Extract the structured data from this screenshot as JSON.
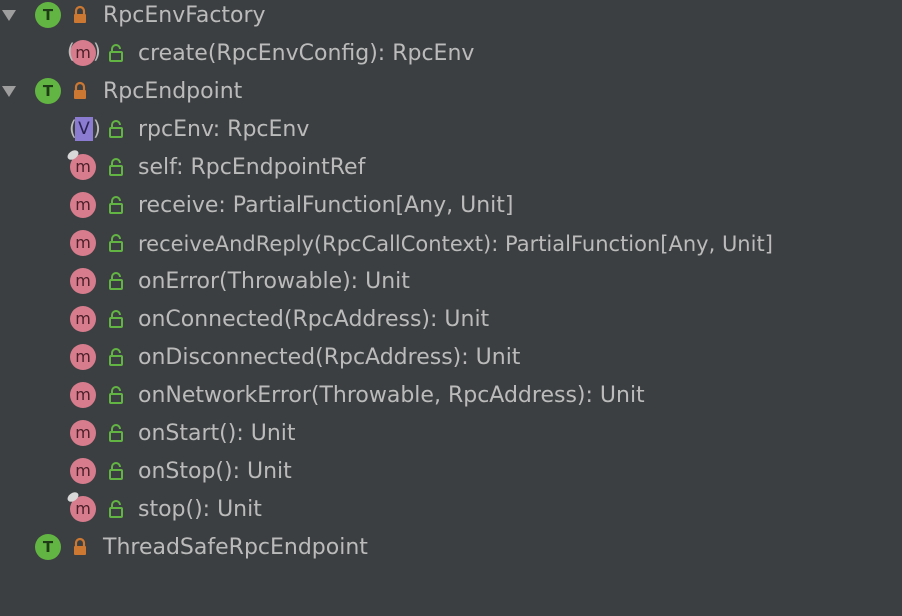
{
  "tree": {
    "items": [
      {
        "kind": "trait",
        "expanded": true,
        "icon": "trait-icon",
        "badge": "T",
        "label": "RpcEnvFactory"
      },
      {
        "kind": "method",
        "abstract": true,
        "icon": "abstract-method-icon",
        "badge": "m",
        "label": "create(RpcEnvConfig): RpcEnv"
      },
      {
        "kind": "trait",
        "expanded": true,
        "icon": "trait-icon",
        "badge": "T",
        "label": "RpcEndpoint"
      },
      {
        "kind": "value",
        "abstract": true,
        "icon": "abstract-value-icon",
        "badge": "V",
        "label": "rpcEnv: RpcEnv"
      },
      {
        "kind": "method",
        "pinned": true,
        "icon": "method-icon",
        "badge": "m",
        "label": "self: RpcEndpointRef"
      },
      {
        "kind": "method",
        "icon": "method-icon",
        "badge": "m",
        "label": "receive: PartialFunction[Any, Unit]"
      },
      {
        "kind": "method",
        "icon": "method-icon",
        "badge": "m",
        "label": "receiveAndReply(RpcCallContext): PartialFunction[Any, Unit]"
      },
      {
        "kind": "method",
        "icon": "method-icon",
        "badge": "m",
        "label": "onError(Throwable): Unit"
      },
      {
        "kind": "method",
        "icon": "method-icon",
        "badge": "m",
        "label": "onConnected(RpcAddress): Unit"
      },
      {
        "kind": "method",
        "icon": "method-icon",
        "badge": "m",
        "label": "onDisconnected(RpcAddress): Unit"
      },
      {
        "kind": "method",
        "icon": "method-icon",
        "badge": "m",
        "label": "onNetworkError(Throwable, RpcAddress): Unit"
      },
      {
        "kind": "method",
        "icon": "method-icon",
        "badge": "m",
        "label": "onStart(): Unit"
      },
      {
        "kind": "method",
        "icon": "method-icon",
        "badge": "m",
        "label": "onStop(): Unit"
      },
      {
        "kind": "method",
        "pinned": true,
        "icon": "method-icon",
        "badge": "m",
        "label": "stop(): Unit"
      },
      {
        "kind": "trait",
        "expanded": false,
        "icon": "trait-icon",
        "badge": "T",
        "label": "ThreadSafeRpcEndpoint"
      }
    ]
  },
  "colors": {
    "background": "#3c3f41",
    "text": "#bbbbbb",
    "trait_badge": "#62b543",
    "method_badge": "#d77c8d",
    "value_badge": "#8b7bd1",
    "class_lock": "#cc7832",
    "member_lock": "#62b543"
  }
}
